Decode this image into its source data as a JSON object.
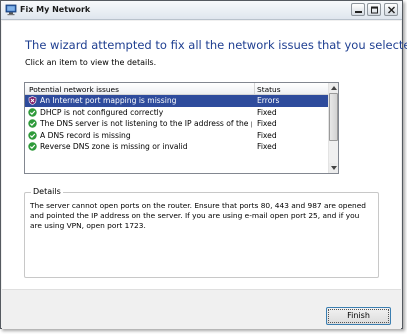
{
  "window": {
    "title": "Fix My Network"
  },
  "heading": "The wizard attempted to fix all the network issues that you selected",
  "instruction": "Click an item to view the details.",
  "list": {
    "columns": [
      "Potential network issues",
      "Status"
    ],
    "rows": [
      {
        "issue": "An Internet port mapping is missing",
        "status": "Errors",
        "icon": "error-shield-icon",
        "selected": true
      },
      {
        "issue": "DHCP is not configured correctly",
        "status": "Fixed",
        "icon": "check-icon",
        "selected": false
      },
      {
        "issue": "The DNS server is not listening to the IP address of the primar...",
        "status": "Fixed",
        "icon": "check-icon",
        "selected": false
      },
      {
        "issue": "A DNS record is missing",
        "status": "Fixed",
        "icon": "check-icon",
        "selected": false
      },
      {
        "issue": "Reverse DNS zone is missing or invalid",
        "status": "Fixed",
        "icon": "check-icon",
        "selected": false
      }
    ]
  },
  "details": {
    "label": "Details",
    "text": "The server cannot open ports on the router. Ensure that ports 80, 443 and 987 are opened and pointed the IP address on the server. If you are using e-mail open port 25, and if you are using VPN, open port 1723."
  },
  "buttons": {
    "finish": "Finish"
  },
  "colors": {
    "heading": "#1f3f91",
    "selection": "#2e4b9c",
    "check": "#2e9a3a",
    "error": "#7a1f6b"
  }
}
